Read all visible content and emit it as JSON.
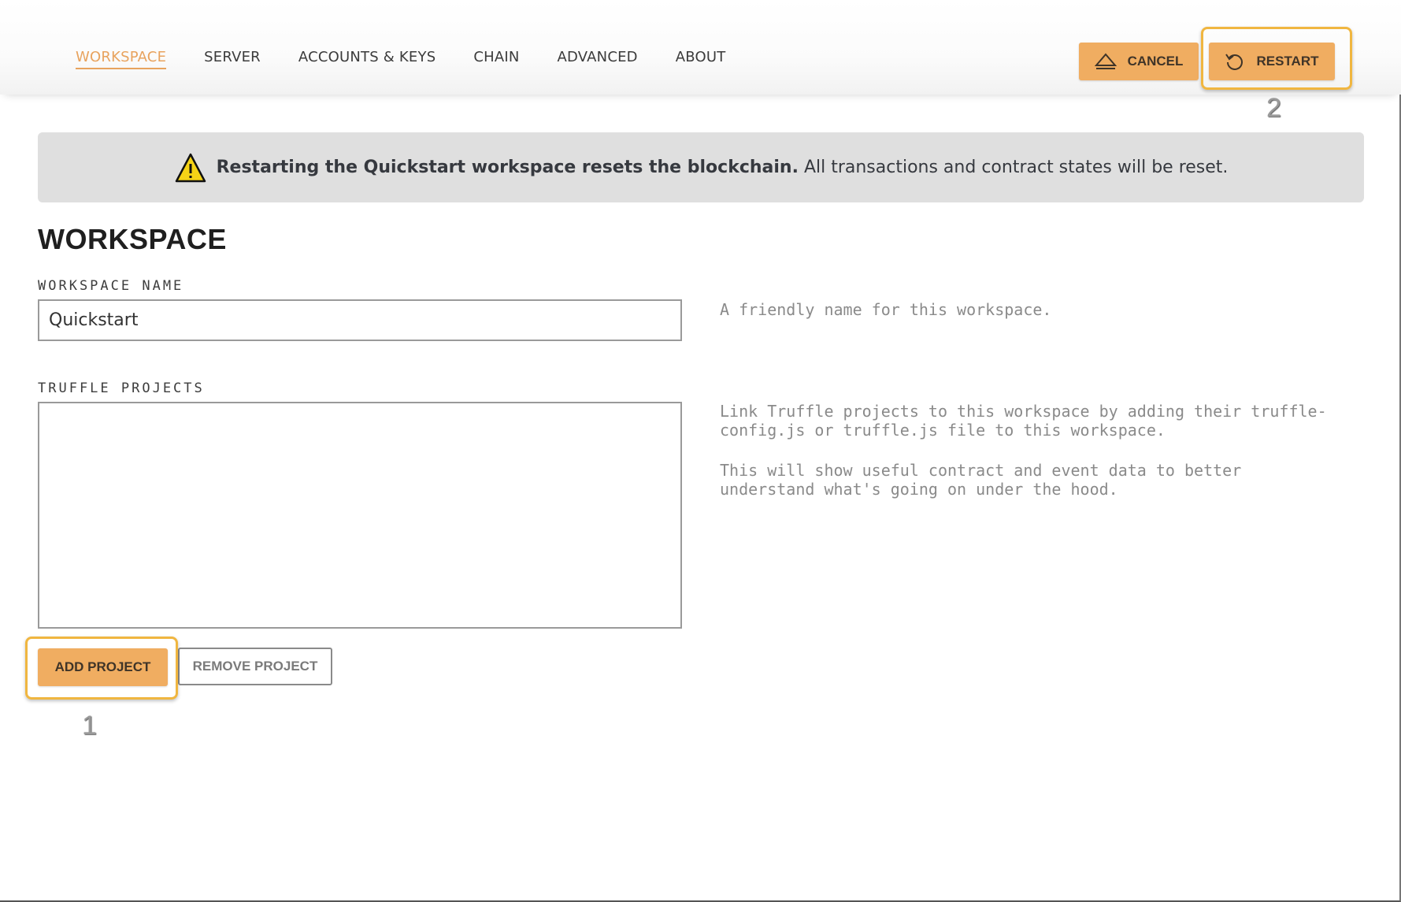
{
  "nav": {
    "tabs": [
      {
        "label": "WORKSPACE",
        "active": true
      },
      {
        "label": "SERVER",
        "active": false
      },
      {
        "label": "ACCOUNTS & KEYS",
        "active": false
      },
      {
        "label": "CHAIN",
        "active": false
      },
      {
        "label": "ADVANCED",
        "active": false
      },
      {
        "label": "ABOUT",
        "active": false
      }
    ],
    "cancel_label": "CANCEL",
    "restart_label": "RESTART"
  },
  "warning": {
    "bold_text": "Restarting the Quickstart workspace resets the blockchain.",
    "text": "All transactions and contract states will be reset."
  },
  "workspace": {
    "title": "WORKSPACE",
    "name_label": "WORKSPACE NAME",
    "name_value": "Quickstart",
    "name_help": "A friendly name for this workspace.",
    "projects_label": "TRUFFLE PROJECTS",
    "projects_help_1": "Link Truffle projects to this workspace by adding their truffle-\nconfig.js or truffle.js file to this workspace.",
    "projects_help_2": "This will show useful contract and event data to better\nunderstand what's going on under the hood.",
    "add_project_label": "ADD PROJECT",
    "remove_project_label": "REMOVE PROJECT"
  },
  "annotations": {
    "callout_1": "1",
    "callout_2": "2"
  },
  "colors": {
    "accent": "#f0ad61",
    "active_tab": "#e8a35e",
    "callout_border": "#f0b640",
    "banner_bg": "#dfdfdf"
  },
  "icons": {
    "cancel": "eject-triangle-icon",
    "restart": "restart-icon",
    "warning": "warning-icon"
  }
}
